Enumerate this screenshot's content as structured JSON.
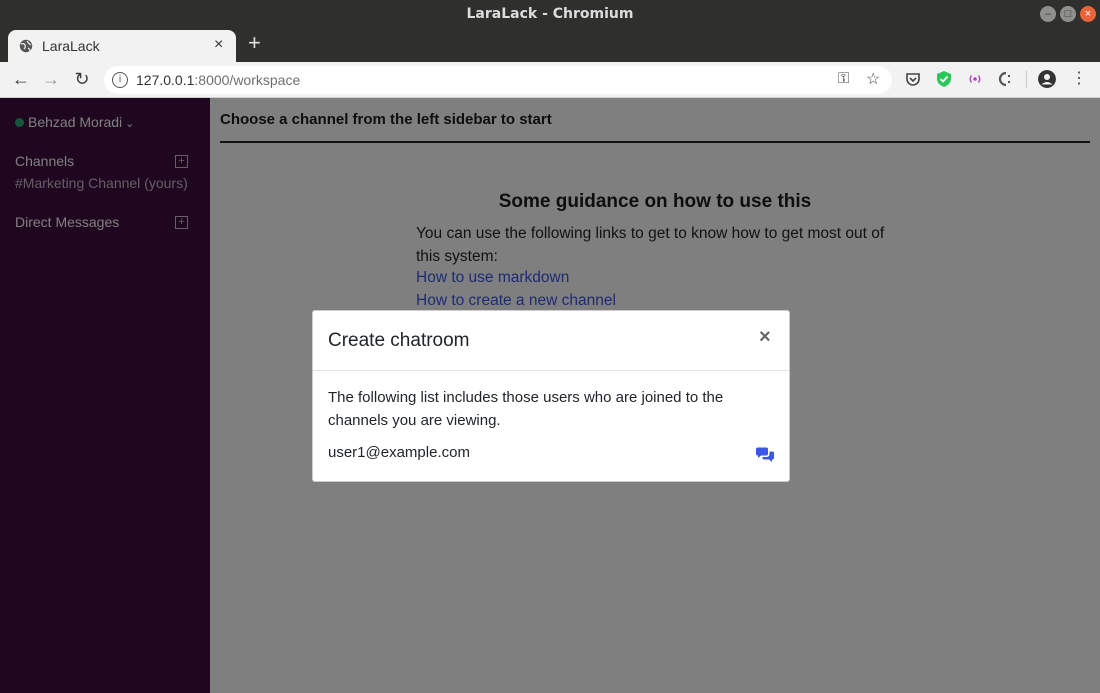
{
  "window": {
    "title": "LaraLack - Chromium"
  },
  "tab": {
    "title": "LaraLack",
    "close_glyph": "×",
    "new_tab_glyph": "+"
  },
  "toolbar": {
    "url_host": "127.0.0.1",
    "url_path": ":8000/workspace",
    "info_glyph": "i",
    "key_glyph": "⚿",
    "star_glyph": "☆",
    "back_glyph": "←",
    "forward_glyph": "→",
    "reload_glyph": "↻",
    "menu_glyph": "⋮"
  },
  "sidebar": {
    "user_name": "Behzad Moradi",
    "status_color": "#2bac76",
    "channels_label": "Channels",
    "channels": [
      "#Marketing Channel (yours)"
    ],
    "direct_messages_label": "Direct Messages",
    "add_glyph": "+"
  },
  "main": {
    "header": "Choose a channel from the left sidebar to start",
    "guide_title": "Some guidance on how to use this",
    "guide_text": "You can use the following links to get to know how to get most out of this system:",
    "links": [
      "How to use markdown",
      "How to create a new channel"
    ]
  },
  "modal": {
    "title": "Create chatroom",
    "close_glyph": "×",
    "body_text": "The following list includes those users who are joined to the channels you are viewing.",
    "users": [
      "user1@example.com"
    ]
  },
  "colors": {
    "sidebar_bg": "#3f0e40",
    "link": "#3a57e8",
    "chat_icon": "#3a57e8"
  }
}
